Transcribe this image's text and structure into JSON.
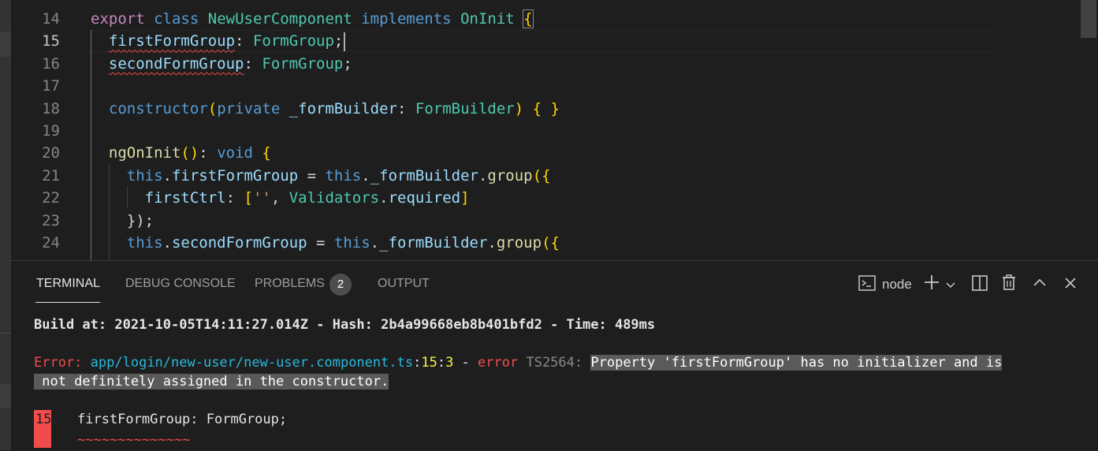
{
  "editor": {
    "lines": [
      {
        "num": "14",
        "segments": [
          {
            "t": "export",
            "c": "ctl"
          },
          {
            "t": " "
          },
          {
            "t": "class",
            "c": "kw"
          },
          {
            "t": " "
          },
          {
            "t": "NewUserComponent",
            "c": "cls"
          },
          {
            "t": " "
          },
          {
            "t": "implements",
            "c": "kw"
          },
          {
            "t": " "
          },
          {
            "t": "OnInit",
            "c": "cls"
          },
          {
            "t": " "
          },
          {
            "t": "{",
            "c": "br bm"
          }
        ]
      },
      {
        "num": "15",
        "active": true,
        "segments": [
          {
            "t": "  "
          },
          {
            "t": "firstFormGroup",
            "c": "prop squig"
          },
          {
            "t": ": "
          },
          {
            "t": "FormGroup",
            "c": "cls"
          },
          {
            "t": ";"
          }
        ]
      },
      {
        "num": "16",
        "segments": [
          {
            "t": "  "
          },
          {
            "t": "secondFormGroup",
            "c": "prop squig"
          },
          {
            "t": ": "
          },
          {
            "t": "FormGroup",
            "c": "cls"
          },
          {
            "t": ";"
          }
        ]
      },
      {
        "num": "17",
        "segments": []
      },
      {
        "num": "18",
        "segments": [
          {
            "t": "  "
          },
          {
            "t": "constructor",
            "c": "kw"
          },
          {
            "t": "(",
            "c": "br"
          },
          {
            "t": "private",
            "c": "kw"
          },
          {
            "t": " "
          },
          {
            "t": "_formBuilder",
            "c": "prop"
          },
          {
            "t": ": "
          },
          {
            "t": "FormBuilder",
            "c": "cls"
          },
          {
            "t": ")",
            "c": "br"
          },
          {
            "t": " "
          },
          {
            "t": "{ }",
            "c": "br"
          }
        ]
      },
      {
        "num": "19",
        "segments": []
      },
      {
        "num": "20",
        "segments": [
          {
            "t": "  "
          },
          {
            "t": "ngOnInit",
            "c": "fn"
          },
          {
            "t": "()",
            "c": "br"
          },
          {
            "t": ": "
          },
          {
            "t": "void",
            "c": "kw"
          },
          {
            "t": " "
          },
          {
            "t": "{",
            "c": "br"
          }
        ]
      },
      {
        "num": "21",
        "segments": [
          {
            "t": "    "
          },
          {
            "t": "this",
            "c": "kw"
          },
          {
            "t": "."
          },
          {
            "t": "firstFormGroup",
            "c": "prop"
          },
          {
            "t": " = "
          },
          {
            "t": "this",
            "c": "kw"
          },
          {
            "t": "."
          },
          {
            "t": "_formBuilder",
            "c": "prop"
          },
          {
            "t": "."
          },
          {
            "t": "group",
            "c": "fn"
          },
          {
            "t": "({",
            "c": "br"
          }
        ]
      },
      {
        "num": "22",
        "segments": [
          {
            "t": "      "
          },
          {
            "t": "firstCtrl",
            "c": "prop"
          },
          {
            "t": ": "
          },
          {
            "t": "[",
            "c": "br"
          },
          {
            "t": "''",
            "c": "str"
          },
          {
            "t": ", "
          },
          {
            "t": "Validators",
            "c": "cls"
          },
          {
            "t": "."
          },
          {
            "t": "required",
            "c": "prop"
          },
          {
            "t": "]",
            "c": "br"
          }
        ]
      },
      {
        "num": "23",
        "segments": [
          {
            "t": "    "
          },
          {
            "t": "});",
            "c": ""
          }
        ]
      },
      {
        "num": "24",
        "segments": [
          {
            "t": "    "
          },
          {
            "t": "this",
            "c": "kw"
          },
          {
            "t": "."
          },
          {
            "t": "secondFormGroup",
            "c": "prop"
          },
          {
            "t": " = "
          },
          {
            "t": "this",
            "c": "kw"
          },
          {
            "t": "."
          },
          {
            "t": "_formBuilder",
            "c": "prop"
          },
          {
            "t": "."
          },
          {
            "t": "group",
            "c": "fn"
          },
          {
            "t": "({",
            "c": "br"
          }
        ]
      }
    ]
  },
  "panel": {
    "tabs": {
      "terminal": "TERMINAL",
      "debug_console": "DEBUG CONSOLE",
      "problems": "PROBLEMS",
      "problems_count": "2",
      "output": "OUTPUT"
    },
    "terminal_profile": "node",
    "icons": {
      "terminal": "terminal-icon",
      "add": "plus-icon",
      "dropdown": "chevron-down-icon",
      "split": "split-terminal-icon",
      "kill": "trash-icon",
      "maximize": "chevron-up-icon",
      "close": "close-icon"
    }
  },
  "terminal": {
    "build_prefix": "Build at: ",
    "build_time": "2021-10-05T14:11:27.014Z",
    "hash_prefix": " - Hash: ",
    "hash": "2b4a99668eb8b401bfd2",
    "time_prefix": " - Time: ",
    "time": "489ms",
    "error_label": "Error:",
    "file": "app/login/new-user/new-user.component.ts",
    "line": "15",
    "col": "3",
    "error_word": "error",
    "code": "TS2564:",
    "message_line1": "Property 'firstFormGroup' has no initializer and is",
    "message_line2": " not definitely assigned in the constructor.",
    "snippet_line_num": "15",
    "snippet_code": "firstFormGroup: FormGroup;",
    "squiggle": "~~~~~~~~~~~~~~"
  }
}
